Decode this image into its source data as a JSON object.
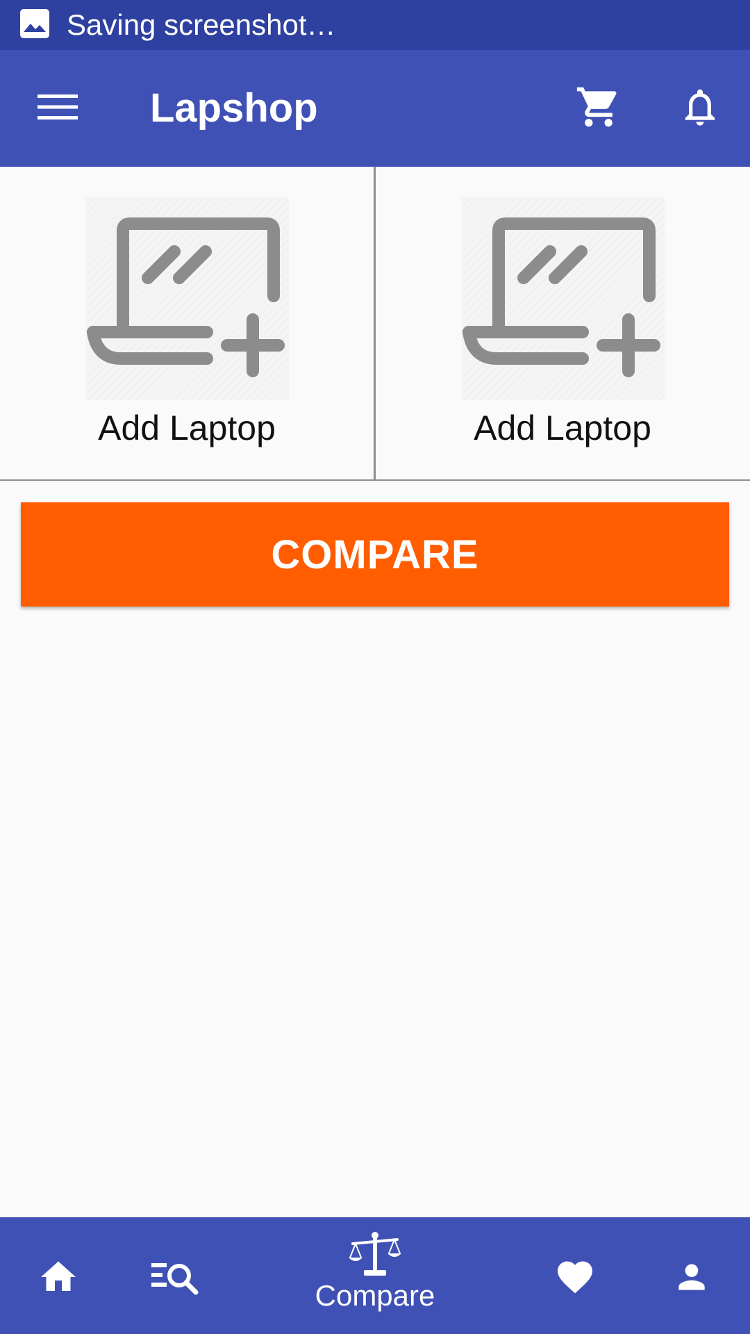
{
  "status_bar": {
    "notification_icon": "image-icon",
    "text": "Saving screenshot…"
  },
  "app_bar": {
    "menu_icon": "hamburger-menu-icon",
    "title": "Lapshop",
    "cart_icon": "shopping-cart-icon",
    "notifications_icon": "bell-icon"
  },
  "compare_slots": [
    {
      "icon": "add-laptop-icon",
      "label": "Add Laptop"
    },
    {
      "icon": "add-laptop-icon",
      "label": "Add Laptop"
    }
  ],
  "compare_button": {
    "label": "COMPARE"
  },
  "bottom_nav": {
    "items": [
      {
        "icon": "home-icon",
        "label": ""
      },
      {
        "icon": "search-list-icon",
        "label": ""
      },
      {
        "icon": "balance-scale-icon",
        "label": "Compare",
        "active": true
      },
      {
        "icon": "heart-icon",
        "label": ""
      },
      {
        "icon": "person-icon",
        "label": ""
      }
    ]
  },
  "colors": {
    "status_bar": "#2f41a0",
    "primary": "#3f51b5",
    "accent": "#ff5d00",
    "background": "#fafafa",
    "icon_gray": "#8c8c8c",
    "divider": "#8d8d8d"
  }
}
